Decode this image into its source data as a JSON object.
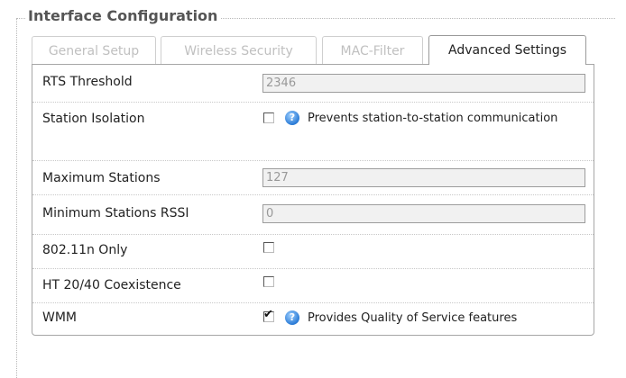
{
  "legend": "Interface Configuration",
  "tabs": [
    {
      "label": "General Setup",
      "active": false
    },
    {
      "label": "Wireless Security",
      "active": false
    },
    {
      "label": "MAC-Filter",
      "active": false
    },
    {
      "label": "Advanced Settings",
      "active": true
    }
  ],
  "fields": {
    "rts_threshold": {
      "label": "RTS Threshold",
      "value": "2346"
    },
    "station_isolation": {
      "label": "Station Isolation",
      "checked": false,
      "help": "?",
      "description": "Prevents station-to-station communication"
    },
    "maximum_stations": {
      "label": "Maximum Stations",
      "value": "127"
    },
    "minimum_rssi": {
      "label": "Minimum Stations RSSI",
      "value": "0"
    },
    "n_only": {
      "label": "802.11n Only",
      "checked": false
    },
    "ht_coexistence": {
      "label": "HT 20/40 Coexistence",
      "checked": false
    },
    "wmm": {
      "label": "WMM",
      "checked": true,
      "tick": "✔",
      "help": "?",
      "description": "Provides Quality of Service features"
    }
  }
}
